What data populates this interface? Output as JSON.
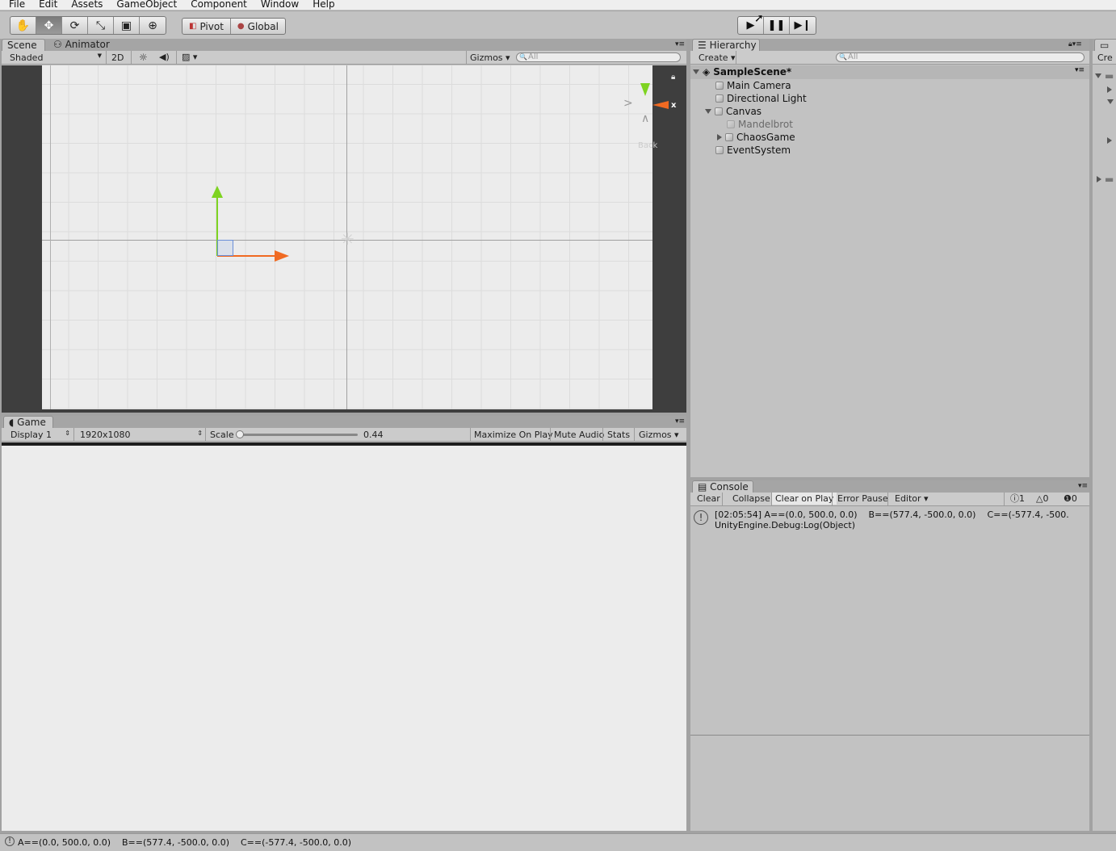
{
  "menu": [
    "File",
    "Edit",
    "Assets",
    "GameObject",
    "Component",
    "Window",
    "Help"
  ],
  "toolbar": {
    "pivot_label": "Pivot",
    "global_label": "Global"
  },
  "scene": {
    "tab_label": "Scene",
    "animator_tab_label": "Animator",
    "shading_mode": "Shaded",
    "mode_2d_label": "2D",
    "gizmos_label": "Gizmos",
    "search_placeholder": "All",
    "gizmo_axis_label": "x",
    "gizmo_view_label": "Back"
  },
  "game": {
    "tab_label": "Game",
    "display_label": "Display 1",
    "resolution_label": "1920x1080",
    "scale_label": "Scale",
    "scale_value": "0.44",
    "maximize_on_play_label": "Maximize On Play",
    "mute_audio_label": "Mute Audio",
    "stats_label": "Stats",
    "gizmos_label": "Gizmos"
  },
  "hierarchy": {
    "tab_label": "Hierarchy",
    "create_label": "Create",
    "search_placeholder": "All",
    "scene_name": "SampleScene*",
    "items": [
      {
        "label": "Main Camera"
      },
      {
        "label": "Directional Light"
      },
      {
        "label": "Canvas"
      },
      {
        "label": "Mandelbrot"
      },
      {
        "label": "ChaosGame"
      },
      {
        "label": "EventSystem"
      }
    ]
  },
  "project": {
    "create_label": "Cre"
  },
  "console": {
    "tab_label": "Console",
    "clear_label": "Clear",
    "collapse_label": "Collapse",
    "clear_on_play_label": "Clear on Play",
    "error_pause_label": "Error Pause",
    "editor_label": "Editor",
    "info_count": "1",
    "warning_count": "0",
    "error_count": "0",
    "log_line1": "[02:05:54] A==(0.0, 500.0, 0.0)    B==(577.4, -500.0, 0.0)    C==(-577.4, -500.",
    "log_line2": "UnityEngine.Debug:Log(Object)"
  },
  "status_bar": {
    "message": "A==(0.0, 500.0, 0.0)    B==(577.4, -500.0, 0.0)    C==(-577.4, -500.0, 0.0)"
  },
  "colors": {
    "y_axis": "#7ed321",
    "x_axis": "#f06a22",
    "panel_bg": "#c2c2c2",
    "scene_bg": "#ececec",
    "scene_dark": "#3e3e3e"
  }
}
